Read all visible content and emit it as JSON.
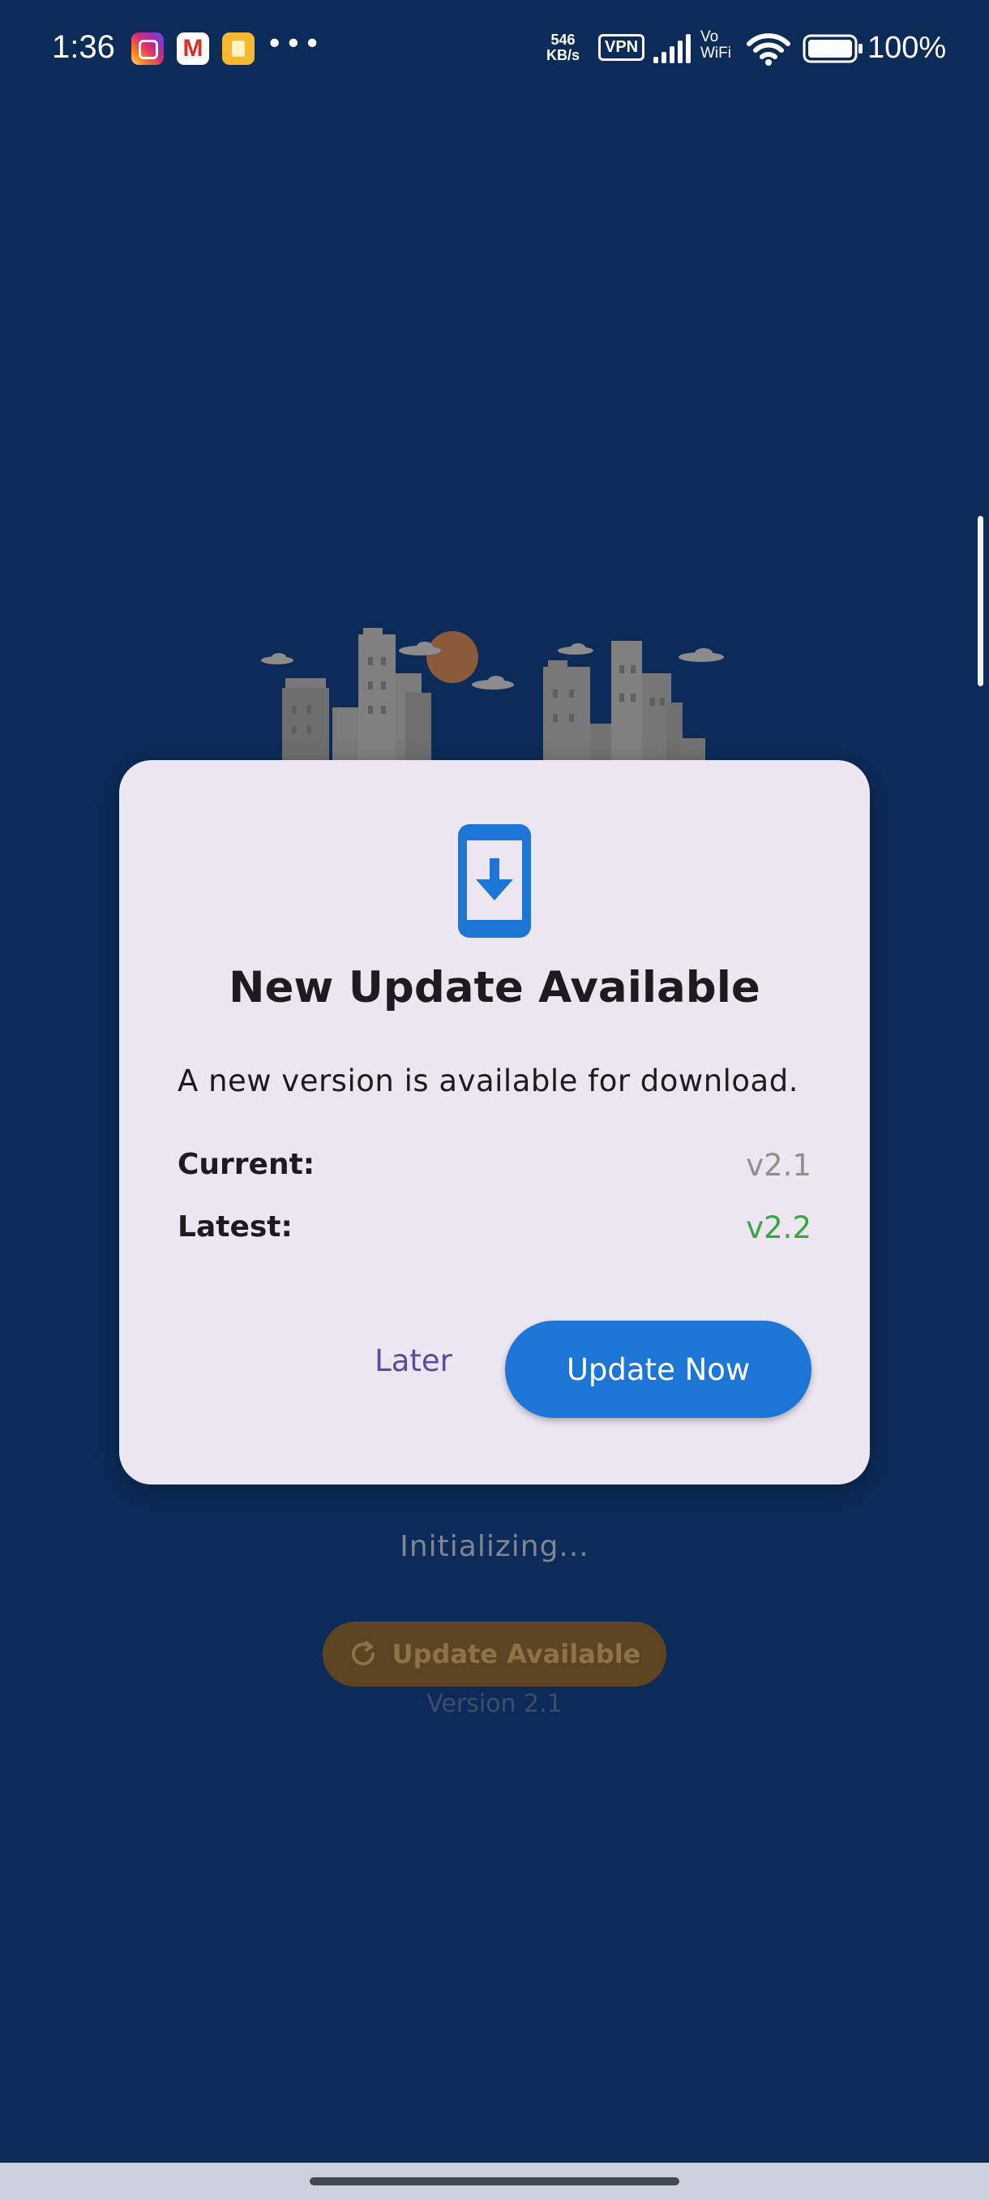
{
  "status_bar": {
    "time": "1:36",
    "net_speed_value": "546",
    "net_speed_unit": "KB/s",
    "vpn_label": "VPN",
    "vowifi_top": "Vo",
    "vowifi_bottom": "WiFi",
    "battery_percent": "100%",
    "more_indicator": "•••",
    "gmail_glyph": "M"
  },
  "background": {
    "status_text": "Initializing...",
    "update_pill_label": "Update Available",
    "version_text": "Version 2.1",
    "pill_icon": "refresh-icon",
    "illustration": "city-skyline-icon"
  },
  "dialog": {
    "icon": "phone-download-icon",
    "title": "New Update Available",
    "message": "A new version is available for download.",
    "current_label": "Current:",
    "current_value": "v2.1",
    "latest_label": "Latest:",
    "latest_value": "v2.2",
    "later_label": "Later",
    "update_now_label": "Update Now"
  },
  "colors": {
    "background": "#0c2b58",
    "dialog_surface": "#ece6f0",
    "primary": "#1d76d6",
    "latest_value": "#3aa345",
    "later_text": "#5b4b9a",
    "pill_background": "#5c4423"
  }
}
